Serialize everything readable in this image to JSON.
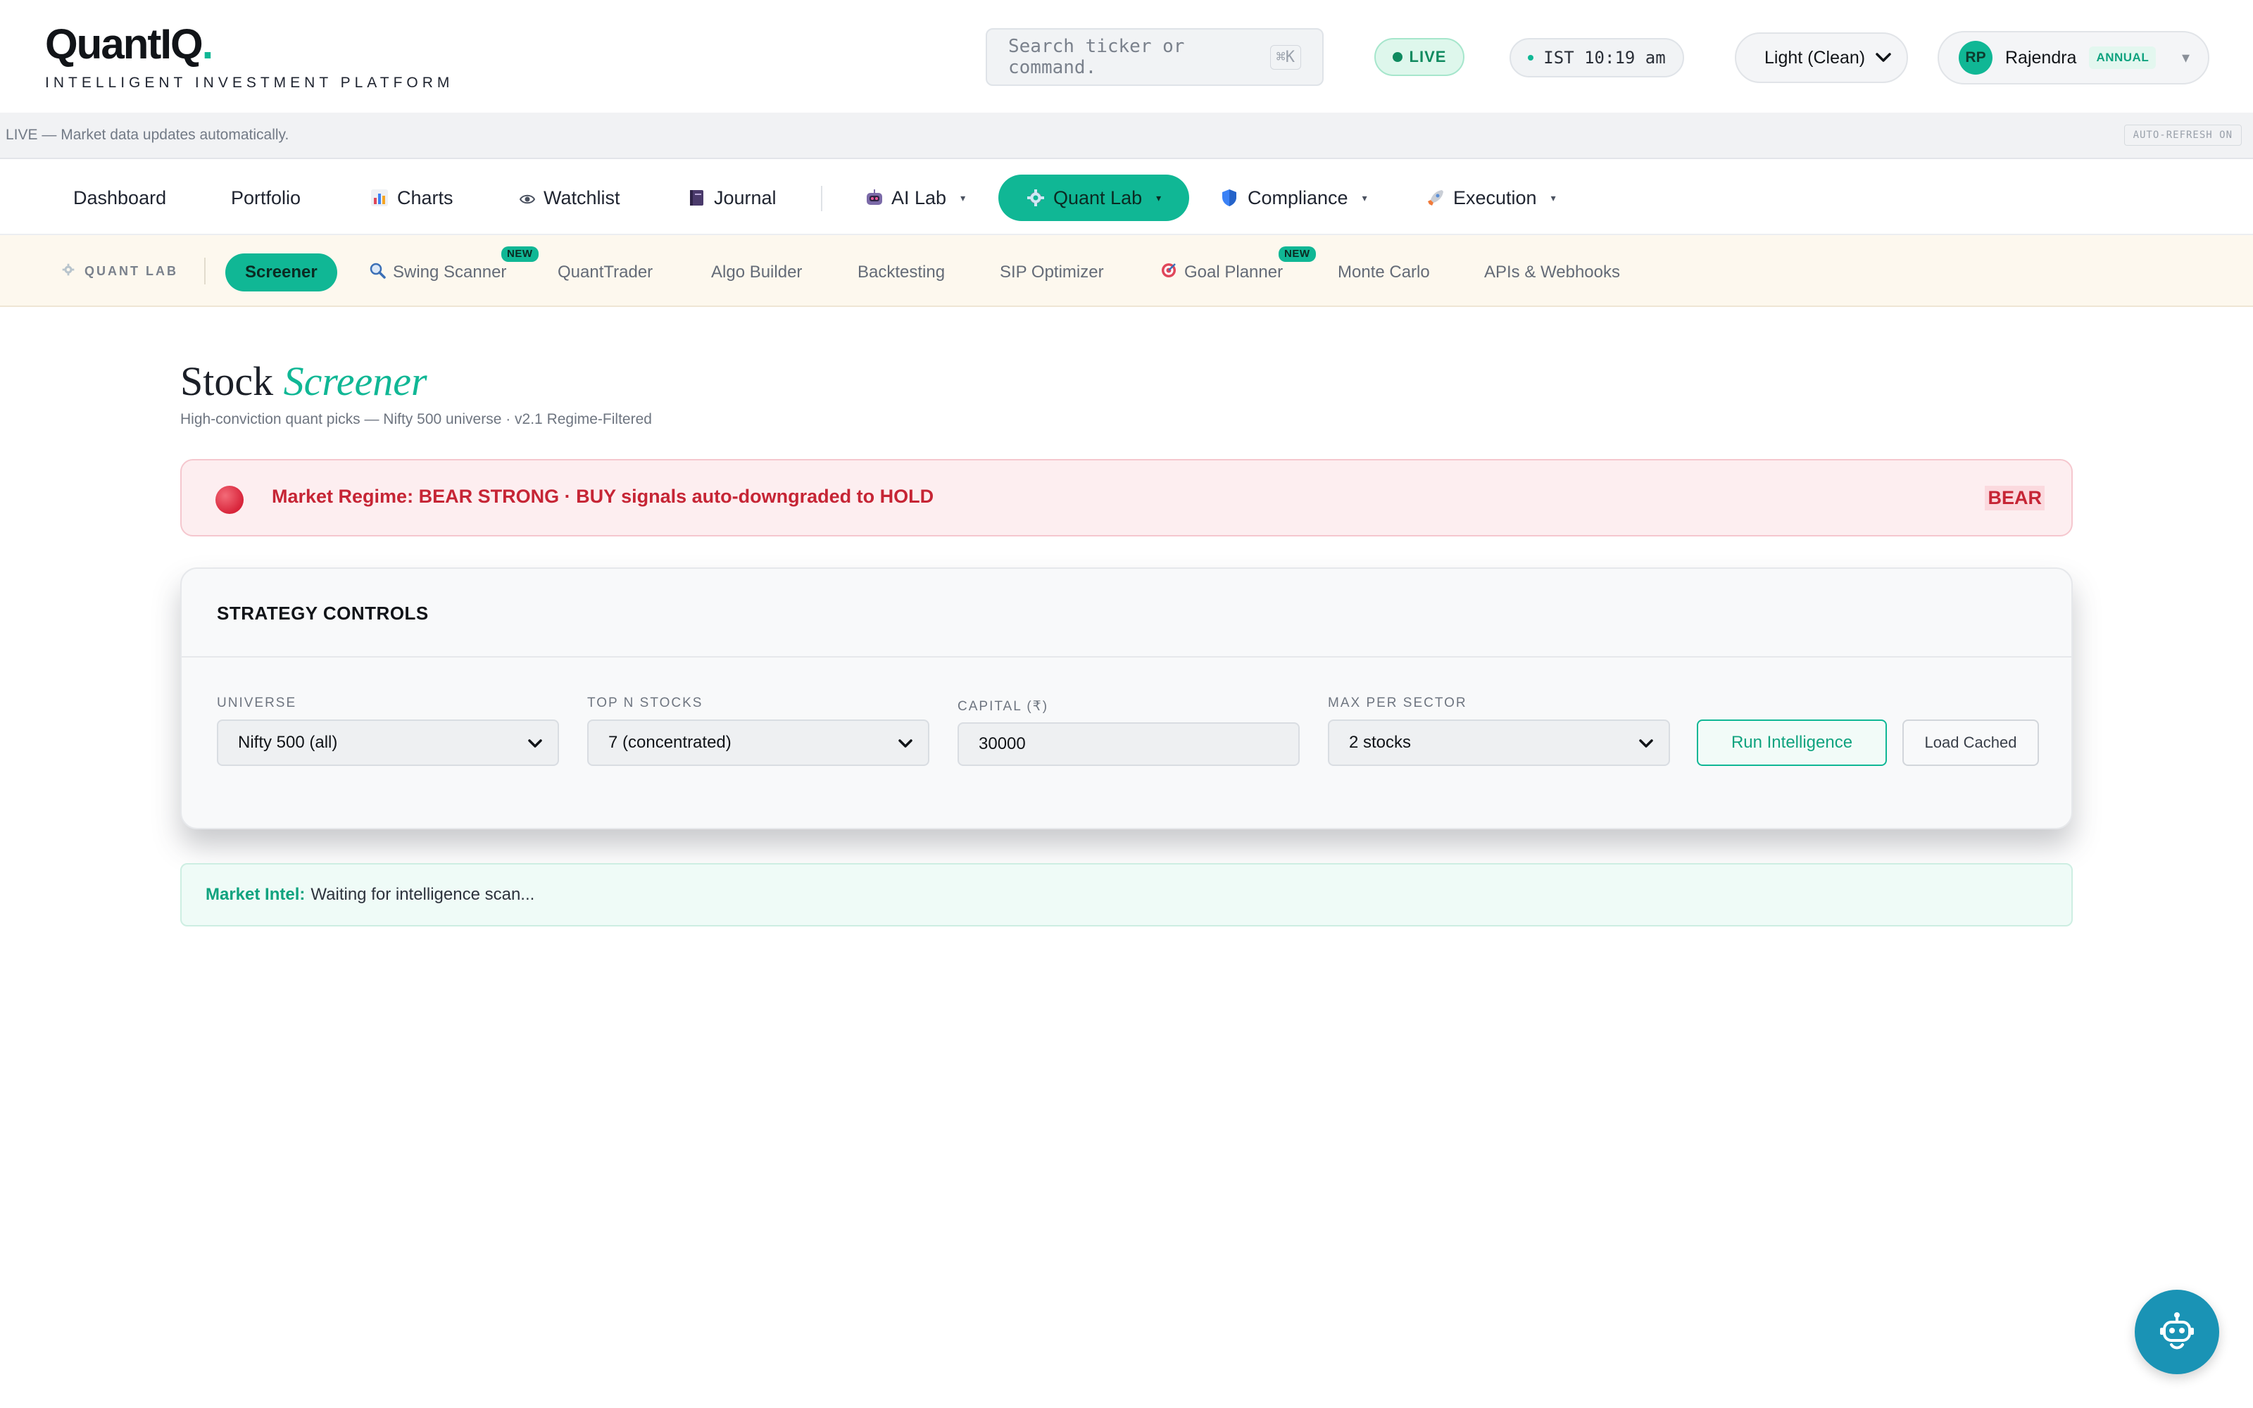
{
  "header": {
    "logo_text": "QuantIQ",
    "logo_dot": ".",
    "tagline": "INTELLIGENT INVESTMENT PLATFORM",
    "search_placeholder": "Search ticker or command.",
    "search_shortcut": "⌘K",
    "live_label": "LIVE",
    "time": "IST 10:19 am",
    "theme": "Light (Clean)",
    "user": {
      "initials": "RP",
      "name": "Rajendra",
      "plan": "ANNUAL"
    }
  },
  "banner": {
    "message": "LIVE — Market data updates automatically.",
    "auto_refresh": "AUTO-REFRESH ON"
  },
  "main_nav": {
    "items": [
      {
        "label": "Dashboard"
      },
      {
        "label": "Portfolio"
      },
      {
        "label": "Charts",
        "icon": "bar-chart-icon"
      },
      {
        "label": "Watchlist",
        "icon": "eye-icon"
      },
      {
        "label": "Journal",
        "icon": "notebook-icon"
      },
      {
        "label": "AI Lab",
        "icon": "robot-icon",
        "dropdown": true
      },
      {
        "label": "Quant Lab",
        "icon": "gear-icon",
        "dropdown": true,
        "active": true
      },
      {
        "label": "Compliance",
        "icon": "shield-icon",
        "dropdown": true
      },
      {
        "label": "Execution",
        "icon": "rocket-icon",
        "dropdown": true
      }
    ],
    "caret": "▾"
  },
  "sub_nav": {
    "section_label": "QUANT LAB",
    "items": [
      {
        "label": "Screener",
        "active": true
      },
      {
        "label": "Swing Scanner",
        "icon": "magnifier-icon",
        "badge": "NEW"
      },
      {
        "label": "QuantTrader"
      },
      {
        "label": "Algo Builder"
      },
      {
        "label": "Backtesting"
      },
      {
        "label": "SIP Optimizer"
      },
      {
        "label": "Goal Planner",
        "icon": "target-icon",
        "badge": "NEW"
      },
      {
        "label": "Monte Carlo"
      },
      {
        "label": "APIs & Webhooks"
      }
    ]
  },
  "page": {
    "title_plain": "Stock",
    "title_accent": "Screener",
    "subtitle": "High-conviction quant picks — Nifty 500 universe · v2.1 Regime-Filtered"
  },
  "regime": {
    "message": "Market Regime: BEAR STRONG · BUY signals auto-downgraded to HOLD",
    "tag": "BEAR",
    "color": "#c62535"
  },
  "controls": {
    "title": "STRATEGY CONTROLS",
    "universe": {
      "label": "UNIVERSE",
      "value": "Nifty 500 (all)"
    },
    "top_n": {
      "label": "TOP N STOCKS",
      "value": "7 (concentrated)"
    },
    "capital": {
      "label": "CAPITAL (₹)",
      "value": "30000"
    },
    "max_sector": {
      "label": "MAX PER SECTOR",
      "value": "2 stocks"
    },
    "run_button": "Run Intelligence",
    "load_button": "Load Cached"
  },
  "intel": {
    "label": "Market Intel:",
    "message": "Waiting for intelligence scan..."
  },
  "colors": {
    "accent": "#10b795",
    "bear": "#c62535",
    "fab": "#1a93b5"
  }
}
